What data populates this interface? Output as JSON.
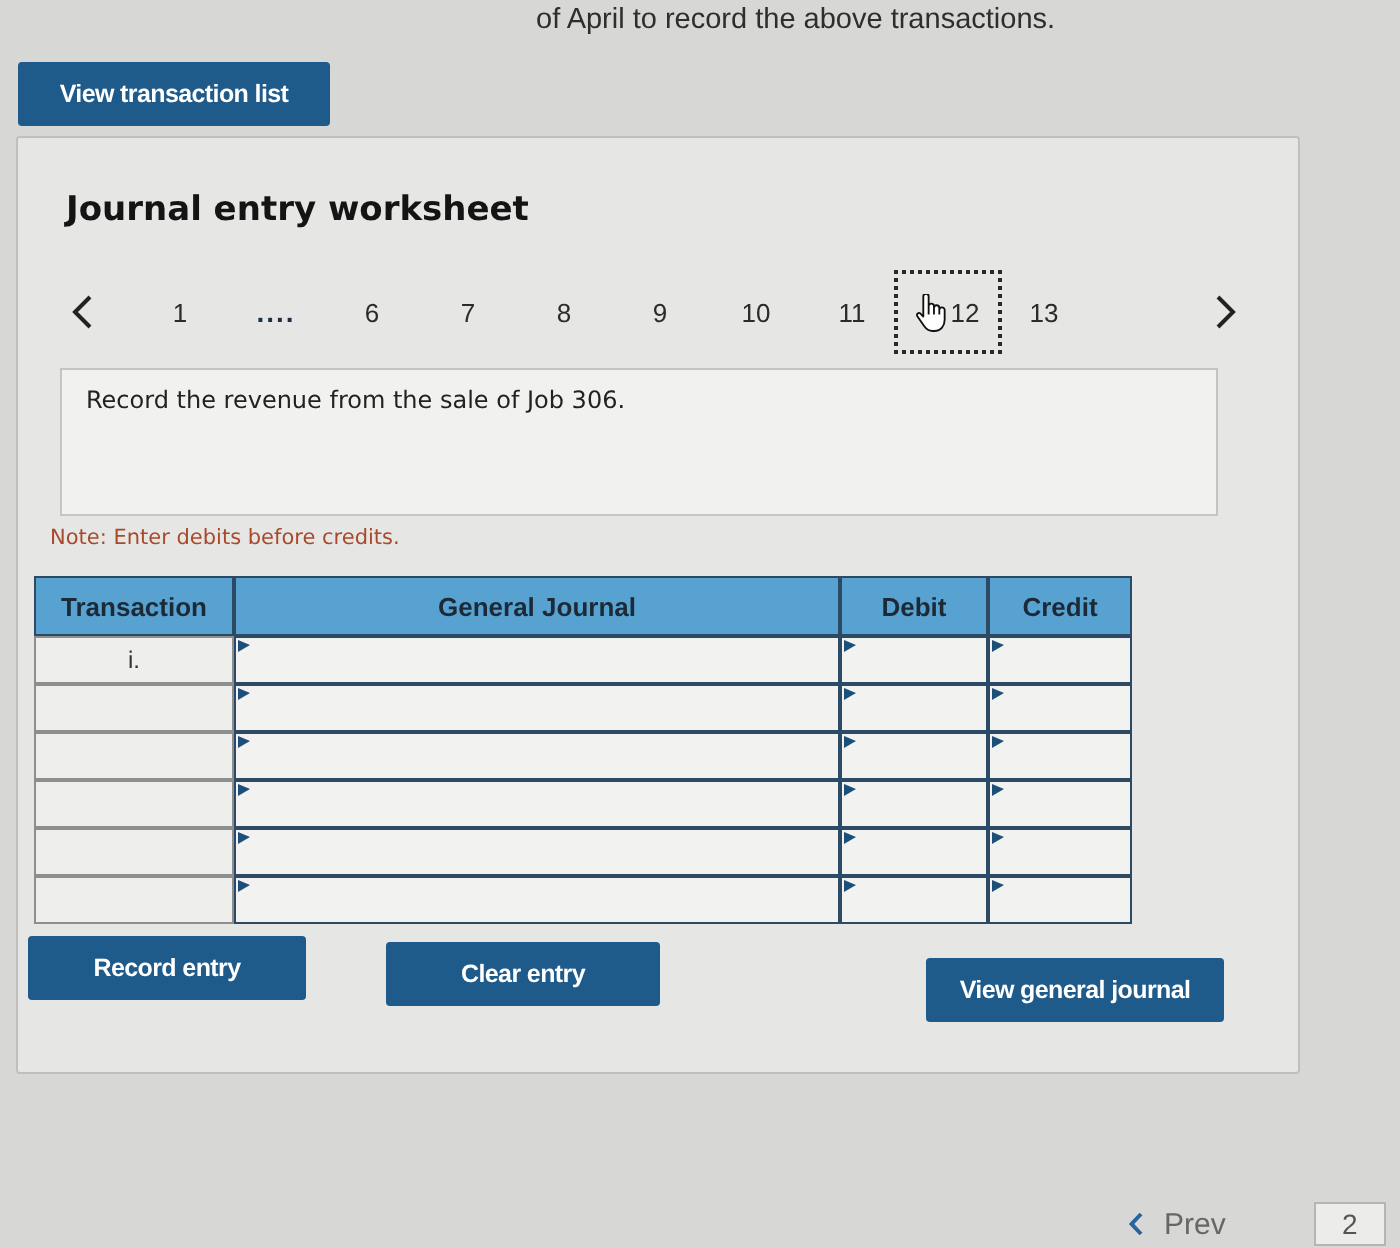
{
  "instruction": {
    "text": "of April to record the above transactions."
  },
  "view_transaction_list": {
    "label": "View transaction list"
  },
  "worksheet": {
    "title": "Journal entry worksheet",
    "steps": [
      {
        "kind": "step",
        "label": "1",
        "selected": false
      },
      {
        "kind": "gap",
        "label": "....",
        "selected": false
      },
      {
        "kind": "step",
        "label": "6",
        "selected": false
      },
      {
        "kind": "step",
        "label": "7",
        "selected": false
      },
      {
        "kind": "step",
        "label": "8",
        "selected": false
      },
      {
        "kind": "step",
        "label": "9",
        "selected": false
      },
      {
        "kind": "step",
        "label": "10",
        "selected": false
      },
      {
        "kind": "step",
        "label": "11",
        "selected": false
      },
      {
        "kind": "step",
        "label": "12",
        "selected": true
      },
      {
        "kind": "step",
        "label": "13",
        "selected": false
      }
    ],
    "prompt": "Record the revenue from the sale of Job 306.",
    "note": "Note: Enter debits before credits.",
    "table": {
      "columns": [
        "Transaction",
        "General Journal",
        "Debit",
        "Credit"
      ],
      "rows": [
        {
          "transaction": "i."
        },
        {},
        {},
        {},
        {},
        {}
      ]
    },
    "buttons": [
      {
        "label": "Record entry"
      },
      {
        "label": "Clear entry"
      },
      {
        "label": "View general journal"
      }
    ]
  },
  "footer": {
    "prev": "Prev",
    "page": "2"
  }
}
